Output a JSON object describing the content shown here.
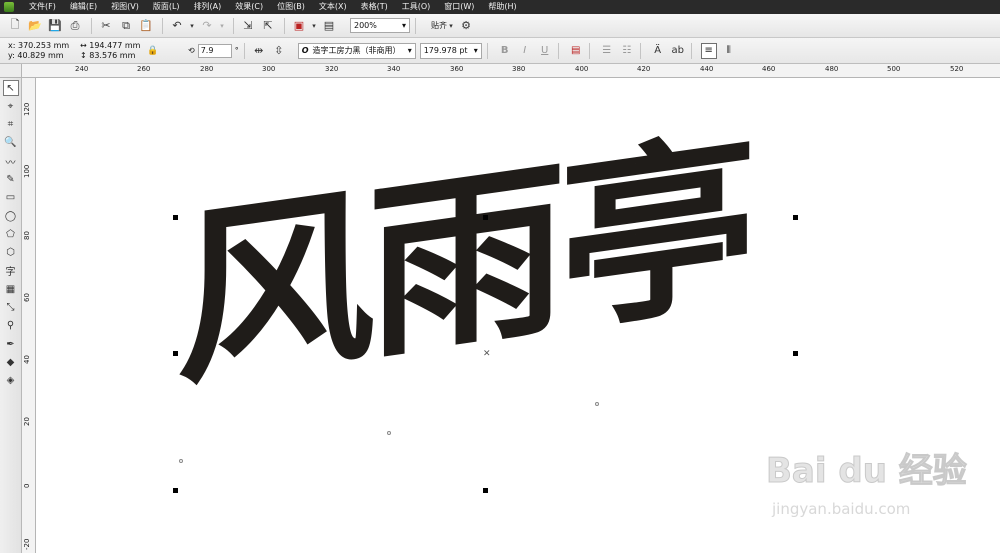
{
  "menu": [
    "文件(F)",
    "编辑(E)",
    "视图(V)",
    "版面(L)",
    "排列(A)",
    "效果(C)",
    "位图(B)",
    "文本(X)",
    "表格(T)",
    "工具(O)",
    "窗口(W)",
    "帮助(H)"
  ],
  "toolbar": {
    "zoom_value": "200%",
    "snap_label": "贴齐"
  },
  "propbar": {
    "x_value": "370.253 mm",
    "y_value": "40.829 mm",
    "x_label": "x:",
    "y_label": "y:",
    "width_value": "194.477 mm",
    "height_value": "83.576 mm",
    "angle_value": "7.9",
    "angle_unit": "°",
    "font_name": "造字工房力黑（非商用）",
    "font_size": "179.978 pt"
  },
  "ruler_top": [
    "240",
    "260",
    "280",
    "300",
    "320",
    "340",
    "360",
    "380",
    "400",
    "420",
    "440",
    "460",
    "480",
    "500",
    "520"
  ],
  "ruler_left": [
    "120",
    "100",
    "80",
    "60",
    "40",
    "20",
    "0",
    "-20"
  ],
  "canvas": {
    "artwork_text": "风雨亭"
  },
  "watermark": {
    "logo_text": "Bai du 经验",
    "url": "jingyan.baidu.com"
  },
  "icons": {
    "toolbar": [
      "new-icon",
      "open-icon",
      "save-icon",
      "print-icon",
      "cut-icon",
      "copy-icon",
      "paste-icon",
      "undo-icon",
      "redo-icon",
      "import-icon",
      "export-icon",
      "launcher-icon",
      "zoom-icon",
      "snap-icon"
    ],
    "toolbox": [
      "pick-tool-icon",
      "shape-tool-icon",
      "crop-tool-icon",
      "zoom-tool-icon",
      "freehand-tool-icon",
      "smart-fill-icon",
      "rectangle-tool-icon",
      "ellipse-tool-icon",
      "polygon-tool-icon",
      "basic-shapes-icon",
      "text-tool-icon",
      "table-tool-icon",
      "parallel-dimension-icon",
      "eyedropper-tool-icon",
      "outline-pen-icon",
      "fill-tool-icon",
      "interactive-fill-icon"
    ]
  }
}
